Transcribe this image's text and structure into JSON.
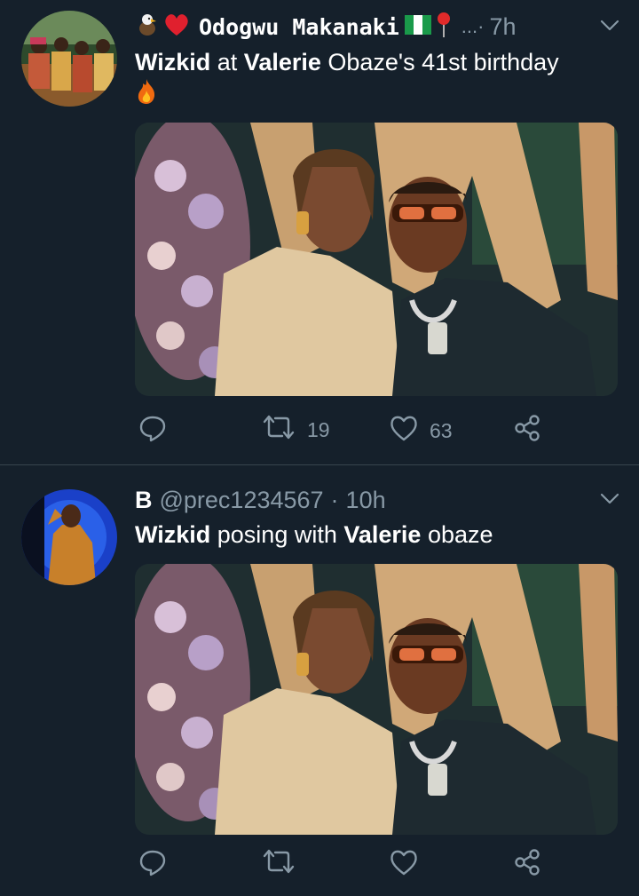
{
  "tweets": [
    {
      "emoji_prefix": [
        "eagle-emoji",
        "red-heart-emoji"
      ],
      "display_name": "Odogwu Makanaki",
      "emoji_suffix": [
        "nigeria-flag-emoji",
        "round-pushpin-emoji"
      ],
      "handle": "",
      "separator": "...·",
      "time": "7h",
      "text_parts": [
        {
          "text": "Wizkid",
          "bold": true
        },
        {
          "text": " at ",
          "bold": false
        },
        {
          "text": "Valerie",
          "bold": true
        },
        {
          "text": " Obaze's 41st birthday",
          "bold": false
        }
      ],
      "text_emoji": "fire-emoji",
      "reply_count": "",
      "retweet_count": "19",
      "like_count": "63"
    },
    {
      "display_name": "B",
      "handle": "@prec1234567",
      "separator": "·",
      "time": "10h",
      "text_parts": [
        {
          "text": "Wizkid",
          "bold": true
        },
        {
          "text": " posing with ",
          "bold": false
        },
        {
          "text": "Valerie",
          "bold": true
        },
        {
          "text": " obaze",
          "bold": false
        }
      ],
      "reply_count": "",
      "retweet_count": "",
      "like_count": ""
    }
  ],
  "colors": {
    "background": "#15202b",
    "secondary_text": "#8899a6",
    "divider": "#38444d"
  }
}
